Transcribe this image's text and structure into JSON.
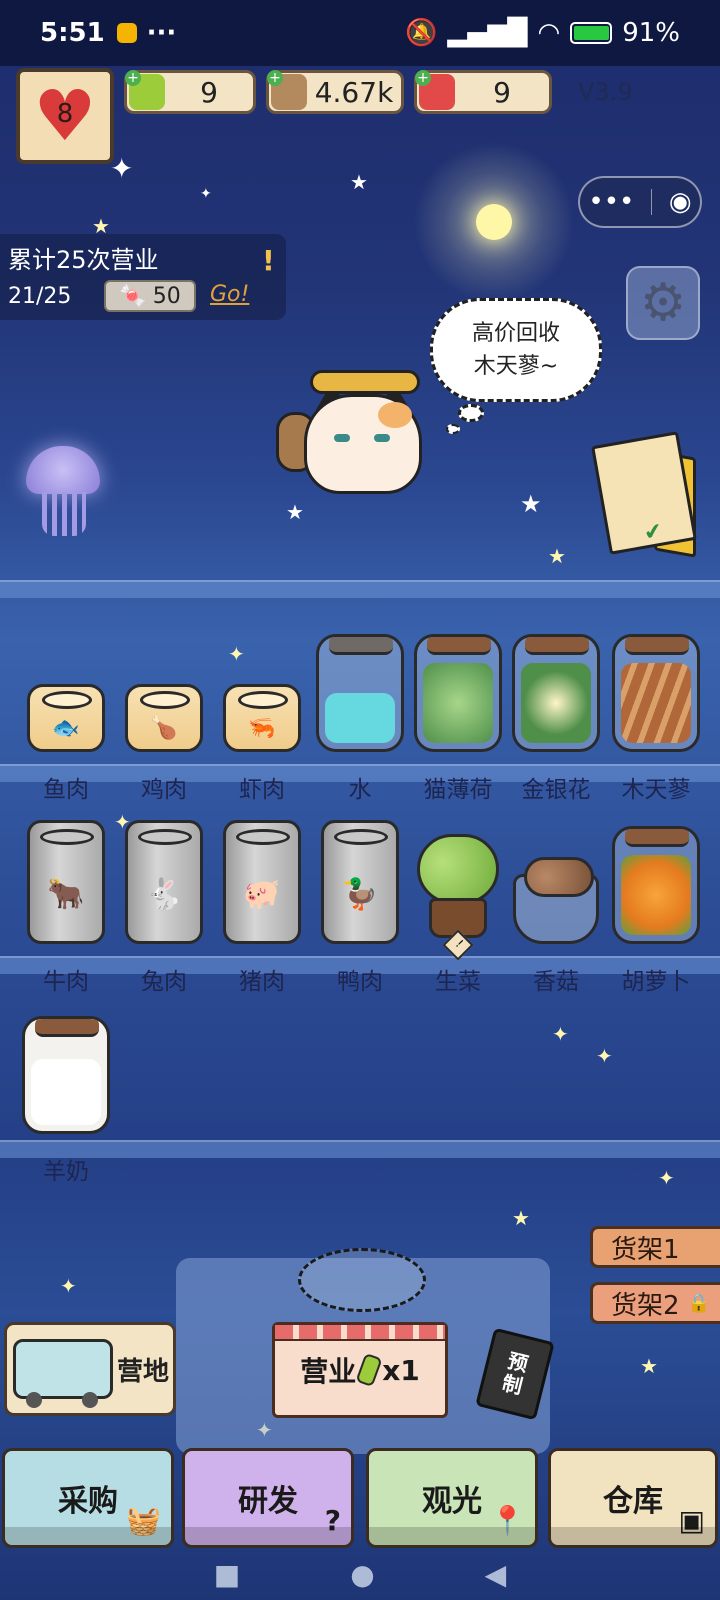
{
  "status_bar": {
    "time": "5:51",
    "overflow": "···",
    "battery": "91%",
    "battery_level": 0.91,
    "icons": [
      "mute-icon",
      "signal-icon",
      "wifi-icon",
      "battery-icon"
    ]
  },
  "resources": {
    "hearts": "8",
    "drink": "9",
    "fish": "4.67k",
    "ticket": "9",
    "version": "V3.9"
  },
  "task": {
    "title": "累计25次营业",
    "progress": "21/25",
    "reward": "50",
    "go": "Go!"
  },
  "bubble": {
    "line1": "高价回收",
    "line2": "木天蓼~"
  },
  "shelf_row1": [
    "鱼肉",
    "鸡肉",
    "虾肉",
    "水",
    "猫薄荷",
    "金银花",
    "木天蓼"
  ],
  "shelf_row2": [
    "牛肉",
    "兔肉",
    "猪肉",
    "鸭肉",
    "生菜",
    "香菇",
    "胡萝卜"
  ],
  "shelf_row3": [
    "羊奶"
  ],
  "shelf_tabs": {
    "tab1": "货架1",
    "tab2": "货架2"
  },
  "actions": {
    "camp": "营地",
    "open": "营业",
    "open_count": "x1",
    "preorder_line1": "预",
    "preorder_line2": "制"
  },
  "nav": {
    "purchase": "采购",
    "research": "研发",
    "sightseeing": "观光",
    "warehouse": "仓库"
  },
  "colors": {
    "nav_purchase": "#b6dde4",
    "nav_research": "#cfb1ec",
    "nav_sightseeing": "#c9e4b7",
    "nav_warehouse": "#f1e2c0",
    "sky": "#223577"
  }
}
